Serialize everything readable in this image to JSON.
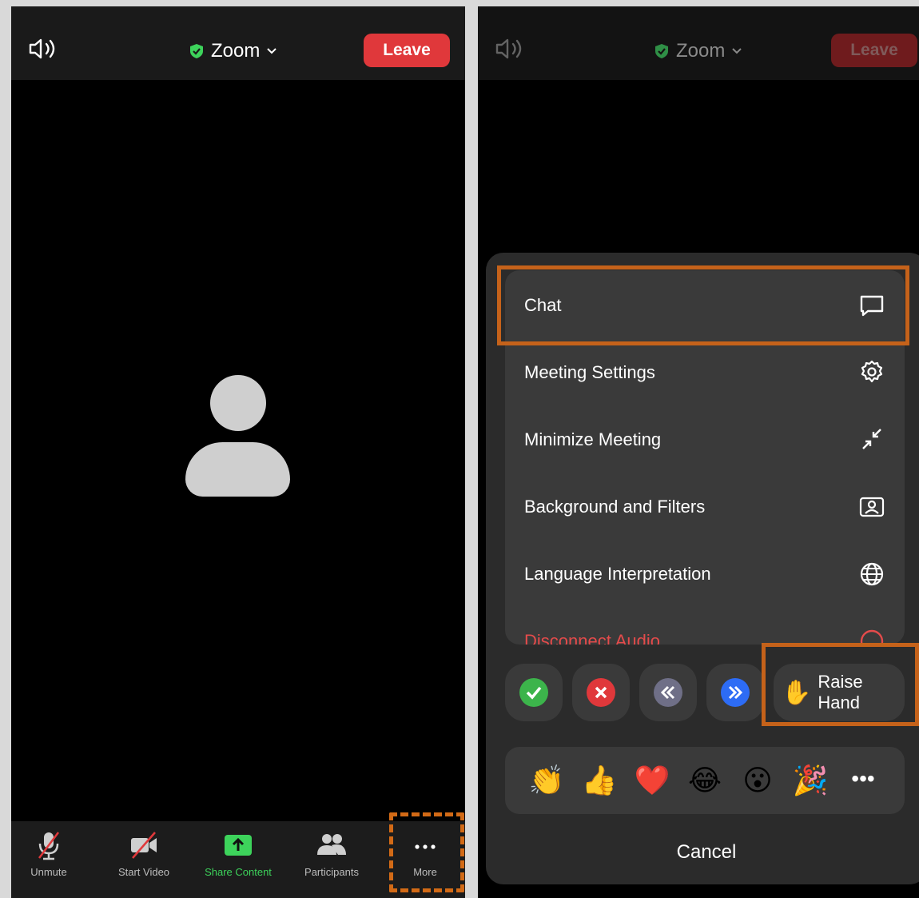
{
  "left": {
    "title": "Zoom",
    "leave_label": "Leave",
    "toolbar": [
      {
        "label": "Unmute",
        "icon": "muted-mic-icon"
      },
      {
        "label": "Start Video",
        "icon": "video-off-icon"
      },
      {
        "label": "Share Content",
        "icon": "share-screen-icon",
        "color": "#3dd35b"
      },
      {
        "label": "Participants",
        "icon": "participants-icon"
      },
      {
        "label": "More",
        "icon": "more-icon"
      }
    ]
  },
  "right": {
    "title": "Zoom",
    "leave_label": "Leave",
    "menu": [
      {
        "label": "Chat",
        "icon": "chat-bubble-icon"
      },
      {
        "label": "Meeting Settings",
        "icon": "gear-icon"
      },
      {
        "label": "Minimize Meeting",
        "icon": "minimize-icon"
      },
      {
        "label": "Background and Filters",
        "icon": "background-person-icon"
      },
      {
        "label": "Language Interpretation",
        "icon": "globe-icon"
      },
      {
        "label": "Disconnect Audio",
        "icon": "disconnect-audio-icon"
      }
    ],
    "raise_hand_label": "Raise Hand",
    "reactions": [
      "👏",
      "👍",
      "❤️",
      "😂",
      "😮",
      "🎉"
    ],
    "more_reactions": "•••",
    "cancel_label": "Cancel",
    "quick_buttons": [
      {
        "icon": "yes-check-icon",
        "color": "#3cb44b"
      },
      {
        "icon": "no-x-icon",
        "color": "#e0383b"
      },
      {
        "icon": "slower-icon",
        "color": "#6f6f87"
      },
      {
        "icon": "faster-icon",
        "color": "#2d6cf5"
      }
    ]
  },
  "accent": {
    "highlight": "#c5621a",
    "leave": "#e0383b",
    "share_green": "#3dd35b"
  }
}
